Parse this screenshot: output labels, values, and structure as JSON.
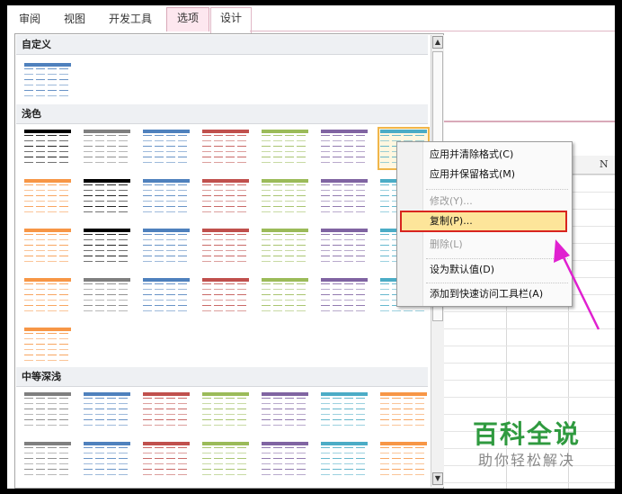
{
  "ribbon": {
    "tabs": [
      {
        "label": "审阅"
      },
      {
        "label": "视图"
      },
      {
        "label": "开发工具"
      },
      {
        "label": "选项"
      },
      {
        "label": "设计"
      }
    ]
  },
  "sheet": {
    "column_header": "N"
  },
  "gallery": {
    "sections": [
      {
        "label": "自定义"
      },
      {
        "label": "浅色"
      },
      {
        "label": "中等深浅"
      }
    ],
    "scroll_up": "▲",
    "scroll_down": "▼"
  },
  "palette": {
    "custom": [
      "#4f81bd"
    ],
    "light": [
      "#000000",
      "#7f7f7f",
      "#4f81bd",
      "#c0504d",
      "#9bbb59",
      "#8064a2",
      "#4bacc6",
      "#f79646",
      "#000000",
      "#4f81bd",
      "#c0504d",
      "#9bbb59",
      "#8064a2",
      "#4bacc6",
      "#f79646",
      "#000000",
      "#4f81bd",
      "#c0504d",
      "#9bbb59",
      "#8064a2",
      "#4bacc6",
      "#f79646",
      "#7f7f7f",
      "#4f81bd",
      "#c0504d",
      "#9bbb59",
      "#8064a2",
      "#4bacc6",
      "#f79646"
    ],
    "medium": [
      "#7f7f7f",
      "#4f81bd",
      "#c0504d",
      "#9bbb59",
      "#8064a2",
      "#4bacc6",
      "#f79646",
      "#7f7f7f",
      "#4f81bd",
      "#c0504d",
      "#9bbb59",
      "#8064a2",
      "#4bacc6",
      "#f79646"
    ]
  },
  "context_menu": {
    "items": [
      {
        "label": "应用并清除格式(C)",
        "enabled": true
      },
      {
        "label": "应用并保留格式(M)",
        "enabled": true
      },
      {
        "label": "修改(Y)...",
        "enabled": false
      },
      {
        "label": "复制(P)...",
        "enabled": true,
        "highlighted": true
      },
      {
        "label": "删除(L)",
        "enabled": false
      },
      {
        "label": "设为默认值(D)",
        "enabled": true
      },
      {
        "label": "添加到快速访问工具栏(A)",
        "enabled": true
      }
    ]
  },
  "watermark": {
    "title": "百科全说",
    "subtitle": "助你轻松解决"
  },
  "colors": {
    "highlight_border": "#d8241f",
    "highlight_fill": "#fde59a",
    "arrow": "#e020d0",
    "watermark_green": "#2f9a3f"
  }
}
